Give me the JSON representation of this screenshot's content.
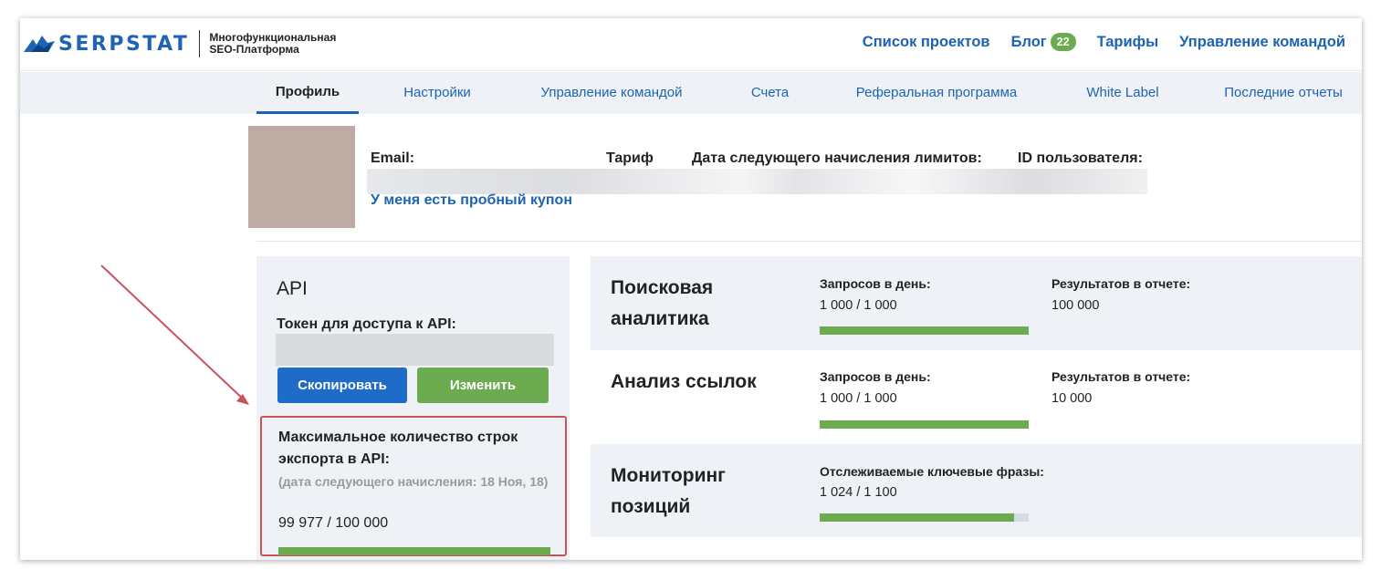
{
  "header": {
    "logo_text": "SERPSTAT",
    "logo_sub_1": "Многофункциональная",
    "logo_sub_2": "SEO-Платформа",
    "nav": {
      "projects": "Список проектов",
      "blog": "Блог",
      "blog_count": "22",
      "pricing": "Тарифы",
      "team": "Управление командой"
    }
  },
  "subnav": {
    "tabs": [
      {
        "label": "Профиль"
      },
      {
        "label": "Настройки"
      },
      {
        "label": "Управление командой"
      },
      {
        "label": "Счета"
      },
      {
        "label": "Реферальная программа"
      },
      {
        "label": "White Label"
      },
      {
        "label": "Последние отчеты"
      }
    ]
  },
  "profile": {
    "email_label": "Email:",
    "tariff_label": "Тариф",
    "next_limits_label": "Дата следующего начисления лимитов:",
    "user_id_label": "ID пользователя:",
    "coupon_link": "У меня есть пробный купон"
  },
  "api": {
    "title": "API",
    "token_label": "Токен для доступа к API:",
    "copy_button": "Скопировать",
    "change_button": "Изменить",
    "max_rows_title": "Максимальное количество строк экспорта в API:",
    "next_accrual": "(дата следующего начисления: 18 Ноя, 18)",
    "usage_value": "99 977 / 100 000",
    "usage_fraction": 0.99977
  },
  "stats": [
    {
      "title": "Поисковая аналитика",
      "col1_label": "Запросов в день:",
      "col1_value": "1 000 / 1 000",
      "col1_fraction": 1.0,
      "col2_label": "Результатов в отчете:",
      "col2_value": "100 000"
    },
    {
      "title": "Анализ ссылок",
      "col1_label": "Запросов в день:",
      "col1_value": "1 000 / 1 000",
      "col1_fraction": 1.0,
      "col2_label": "Результатов в отчете:",
      "col2_value": "10 000"
    },
    {
      "title": "Мониторинг позиций",
      "col1_label": "Отслеживаемые ключевые фразы:",
      "col1_value": "1 024 / 1 100",
      "col1_fraction": 0.931
    }
  ],
  "colors": {
    "brand_blue": "#1f63b4",
    "green": "#6cab4f",
    "highlight_red": "#c9525a",
    "panel_bg": "#eef2f7"
  }
}
